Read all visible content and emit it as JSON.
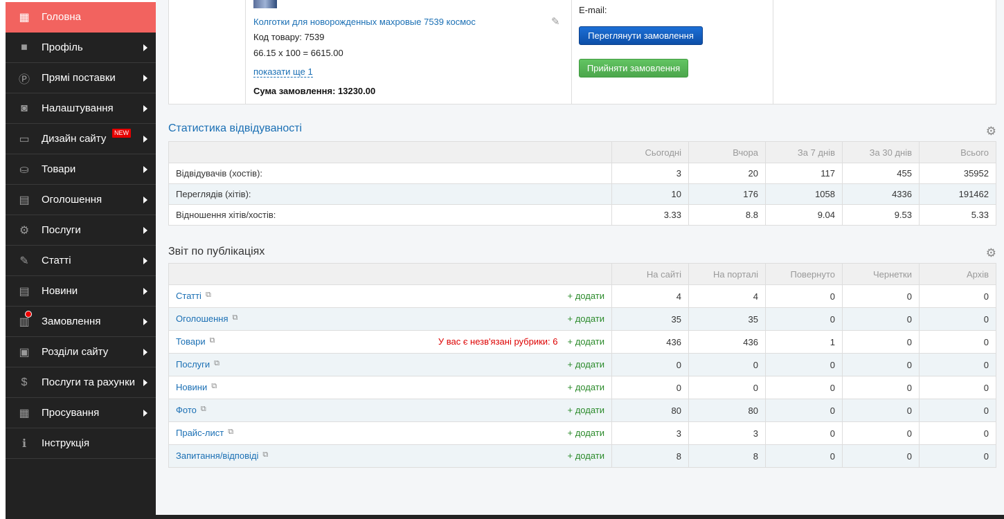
{
  "sidebar": {
    "items": [
      {
        "label": "Головна",
        "icon": "building-icon",
        "glyph": "▦",
        "active": true
      },
      {
        "label": "Профіль",
        "icon": "briefcase-icon",
        "glyph": "■",
        "arrow": true
      },
      {
        "label": "Прямі поставки",
        "icon": "direct-supply-icon",
        "glyph": "Ⓟ",
        "arrow": true
      },
      {
        "label": "Налаштування",
        "icon": "settings-icon",
        "glyph": "◙",
        "arrow": true
      },
      {
        "label": "Дизайн сайту",
        "icon": "window-icon",
        "glyph": "▭",
        "arrow": true,
        "badge": "NEW"
      },
      {
        "label": "Товари",
        "icon": "basket-icon",
        "glyph": "⛀",
        "arrow": true
      },
      {
        "label": "Оголошення",
        "icon": "clipboard-icon",
        "glyph": "▤",
        "arrow": true
      },
      {
        "label": "Послуги",
        "icon": "gear-icon",
        "glyph": "⚙",
        "arrow": true
      },
      {
        "label": "Статті",
        "icon": "pencil-icon",
        "glyph": "✎",
        "arrow": true
      },
      {
        "label": "Новини",
        "icon": "document-icon",
        "glyph": "▤",
        "arrow": true
      },
      {
        "label": "Замовлення",
        "icon": "receipt-icon",
        "glyph": "▥",
        "arrow": true,
        "dot": true
      },
      {
        "label": "Розділи сайту",
        "icon": "file-plus-icon",
        "glyph": "▣",
        "arrow": true
      },
      {
        "label": "Послуги та рахунки",
        "icon": "dollar-icon",
        "glyph": "$",
        "arrow": true
      },
      {
        "label": "Просування",
        "icon": "office-icon",
        "glyph": "▦",
        "arrow": true
      },
      {
        "label": "Інструкція",
        "icon": "info-icon",
        "glyph": "ℹ",
        "arrow": false
      }
    ]
  },
  "order": {
    "product_link": "Колготки для новорожденных махровые 7539 космос",
    "code": "Код товару: 7539",
    "calc": "66.15 x 100 = 6615.00",
    "show_more": "показати ще 1",
    "sum": "Сума замовлення: 13230.00",
    "email_label": "E-mail:",
    "view_button": "Переглянути замовлення",
    "accept_button": "Прийняти замовлення"
  },
  "visits": {
    "title": "Статистика відвідуваності",
    "headers": [
      "",
      "Сьогодні",
      "Вчора",
      "За 7 днів",
      "За 30 днів",
      "Всього"
    ],
    "rows": [
      {
        "label": "Відвідувачів (хостів):",
        "values": [
          "3",
          "20",
          "117",
          "455",
          "35952"
        ]
      },
      {
        "label": "Переглядів (хітів):",
        "values": [
          "10",
          "176",
          "1058",
          "4336",
          "191462"
        ]
      },
      {
        "label": "Відношення хітів/хостів:",
        "values": [
          "3.33",
          "8.8",
          "9.04",
          "9.53",
          "5.33"
        ]
      }
    ]
  },
  "publications": {
    "title": "Звіт по публікаціях",
    "headers": [
      "",
      "На сайті",
      "На порталі",
      "Повернуто",
      "Чернетки",
      "Архів"
    ],
    "add_label": "+ додати",
    "rows": [
      {
        "label": "Статті",
        "values": [
          "4",
          "4",
          "0",
          "0",
          "0"
        ]
      },
      {
        "label": "Оголошення",
        "values": [
          "35",
          "35",
          "0",
          "0",
          "0"
        ]
      },
      {
        "label": "Товари",
        "warning": "У вас є незв'язані рубрики: 6",
        "values": [
          "436",
          "436",
          "1",
          "0",
          "0"
        ]
      },
      {
        "label": "Послуги",
        "values": [
          "0",
          "0",
          "0",
          "0",
          "0"
        ]
      },
      {
        "label": "Новини",
        "values": [
          "0",
          "0",
          "0",
          "0",
          "0"
        ]
      },
      {
        "label": "Фото",
        "values": [
          "80",
          "80",
          "0",
          "0",
          "0"
        ]
      },
      {
        "label": "Прайс-лист",
        "values": [
          "3",
          "3",
          "0",
          "0",
          "0"
        ]
      },
      {
        "label": "Запитання/відповіді",
        "values": [
          "8",
          "8",
          "0",
          "0",
          "0"
        ]
      }
    ]
  },
  "colors": {
    "accent": "#f2635f",
    "sidebar_bg": "#222222",
    "link": "#1a6fb4",
    "add": "#2a8a2a"
  }
}
